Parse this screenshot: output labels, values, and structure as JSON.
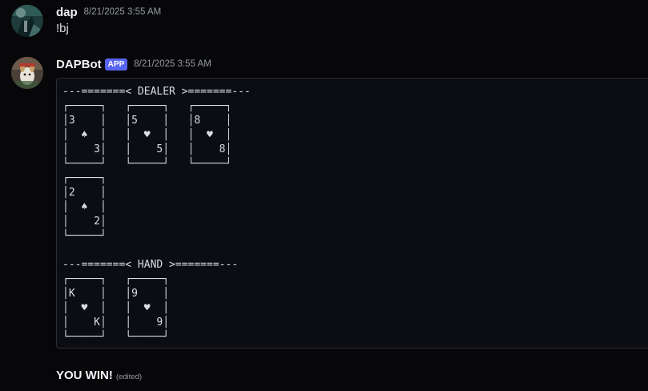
{
  "messages": [
    {
      "username": "dap",
      "timestamp": "8/21/2025 3:55 AM",
      "content": "!bj",
      "avatar_icon": "user-avatar-icon"
    },
    {
      "username": "DAPBot",
      "badge": "APP",
      "timestamp": "8/21/2025 3:55 AM",
      "avatar_icon": "bot-avatar-icon",
      "code_block": "---=======< DEALER >=======---\n┌─────┐   ┌─────┐   ┌─────┐\n│3    │   │5    │   │8    │\n│  ♠  │   │  ♥  │   │  ♥  │\n│    3│   │    5│   │    8│\n└─────┘   └─────┘   └─────┘\n┌─────┐\n│2    │\n│  ♠  │\n│    2│\n└─────┘\n\n---=======< HAND >=======---\n┌─────┐   ┌─────┐\n│K    │   │9    │\n│  ♥  │   │  ♥  │\n│    K│   │    9│\n└─────┘   └─────┘",
      "result": "YOU WIN!",
      "edited_label": "(edited)"
    }
  ],
  "colors": {
    "background": "#070709",
    "app_badge": "#5865f2",
    "code_block_bg": "#0c0d13"
  }
}
